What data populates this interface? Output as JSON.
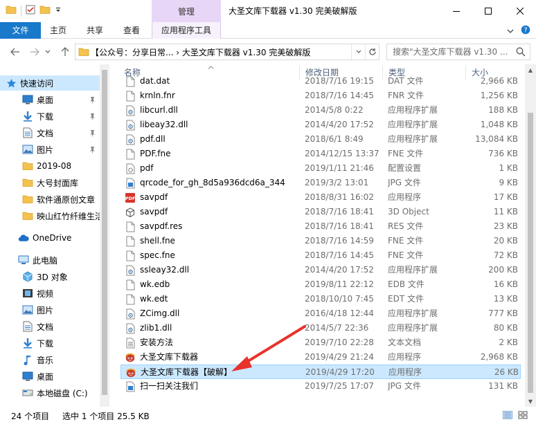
{
  "window": {
    "context_tab_group": "管理",
    "title": "大圣文库下载器 v1.30 完美破解版"
  },
  "ribbon": {
    "tabs": [
      "文件",
      "主页",
      "共享",
      "查看",
      "应用程序工具"
    ]
  },
  "address": {
    "path": "【公众号：分享日常... › 大圣文库下载器 v1.30 完美破解版",
    "search_placeholder": "搜索\"大圣文库下载器 v1.30 ..."
  },
  "nav": {
    "quick_access": "快速访问",
    "items": [
      {
        "label": "桌面",
        "icon": "desktop-icon",
        "pinned": true
      },
      {
        "label": "下载",
        "icon": "download-icon",
        "pinned": true
      },
      {
        "label": "文档",
        "icon": "document-icon",
        "pinned": true
      },
      {
        "label": "图片",
        "icon": "picture-icon",
        "pinned": true
      },
      {
        "label": "2019-08",
        "icon": "folder-icon",
        "pinned": false
      },
      {
        "label": "大号封面库",
        "icon": "folder-icon",
        "pinned": false
      },
      {
        "label": "软件通原创文章",
        "icon": "folder-icon",
        "pinned": false
      },
      {
        "label": "映山红竹纤维生活",
        "icon": "folder-icon",
        "pinned": false
      }
    ],
    "onedrive": "OneDrive",
    "this_pc": "此电脑",
    "pc_items": [
      {
        "label": "3D 对象",
        "icon": "3d-objects-icon"
      },
      {
        "label": "视频",
        "icon": "video-icon"
      },
      {
        "label": "图片",
        "icon": "picture-icon"
      },
      {
        "label": "文档",
        "icon": "document-icon"
      },
      {
        "label": "下载",
        "icon": "download-icon"
      },
      {
        "label": "音乐",
        "icon": "music-icon"
      },
      {
        "label": "桌面",
        "icon": "desktop-icon"
      },
      {
        "label": "本地磁盘 (C:)",
        "icon": "drive-icon"
      }
    ]
  },
  "columns": {
    "name": "名称",
    "date": "修改日期",
    "type": "类型",
    "size": "大小"
  },
  "files": [
    {
      "name": "dat.dat",
      "date": "2018/7/16 19:15",
      "type": "DAT 文件",
      "size": "2,966 KB",
      "icon": "file-icon"
    },
    {
      "name": "krnln.fnr",
      "date": "2018/7/16 14:45",
      "type": "FNR 文件",
      "size": "1,256 KB",
      "icon": "file-icon"
    },
    {
      "name": "libcurl.dll",
      "date": "2014/5/8 0:22",
      "type": "应用程序扩展",
      "size": "188 KB",
      "icon": "dll-icon"
    },
    {
      "name": "libeay32.dll",
      "date": "2014/4/20 17:52",
      "type": "应用程序扩展",
      "size": "1,048 KB",
      "icon": "dll-icon"
    },
    {
      "name": "pdf.dll",
      "date": "2018/6/1 8:49",
      "type": "应用程序扩展",
      "size": "13,084 KB",
      "icon": "dll-icon"
    },
    {
      "name": "PDF.fne",
      "date": "2014/12/15 13:37",
      "type": "FNE 文件",
      "size": "736 KB",
      "icon": "file-icon"
    },
    {
      "name": "pdf",
      "date": "2019/1/11 21:46",
      "type": "配置设置",
      "size": "1 KB",
      "icon": "config-icon"
    },
    {
      "name": "qrcode_for_gh_8d5a936dcd6a_344",
      "date": "2019/3/2 13:01",
      "type": "JPG 文件",
      "size": "9 KB",
      "icon": "image-file-icon"
    },
    {
      "name": "savpdf",
      "date": "2018/8/31 16:02",
      "type": "应用程序",
      "size": "17 KB",
      "icon": "pdf-app-icon"
    },
    {
      "name": "savpdf",
      "date": "2018/7/16 18:41",
      "type": "3D Object",
      "size": "11 KB",
      "icon": "3d-file-icon"
    },
    {
      "name": "savpdf.res",
      "date": "2018/7/16 18:41",
      "type": "RES 文件",
      "size": "23 KB",
      "icon": "file-icon"
    },
    {
      "name": "shell.fne",
      "date": "2018/7/16 14:59",
      "type": "FNE 文件",
      "size": "20 KB",
      "icon": "file-icon"
    },
    {
      "name": "spec.fne",
      "date": "2018/7/16 14:45",
      "type": "FNE 文件",
      "size": "72 KB",
      "icon": "file-icon"
    },
    {
      "name": "ssleay32.dll",
      "date": "2014/4/20 17:52",
      "type": "应用程序扩展",
      "size": "200 KB",
      "icon": "dll-icon"
    },
    {
      "name": "wk.edb",
      "date": "2019/8/11 22:12",
      "type": "EDB 文件",
      "size": "16 KB",
      "icon": "file-icon"
    },
    {
      "name": "wk.edt",
      "date": "2018/10/10 7:45",
      "type": "EDT 文件",
      "size": "13 KB",
      "icon": "file-icon"
    },
    {
      "name": "ZCimg.dll",
      "date": "2016/4/18 12:44",
      "type": "应用程序扩展",
      "size": "777 KB",
      "icon": "dll-icon"
    },
    {
      "name": "zlib1.dll",
      "date": "2014/5/7 22:36",
      "type": "应用程序扩展",
      "size": "80 KB",
      "icon": "dll-icon"
    },
    {
      "name": "安装方法",
      "date": "2019/7/10 22:28",
      "type": "文本文档",
      "size": "2 KB",
      "icon": "text-file-icon"
    },
    {
      "name": "大圣文库下载器",
      "date": "2019/4/29 21:24",
      "type": "应用程序",
      "size": "2,968 KB",
      "icon": "monkey-app-icon"
    },
    {
      "name": "大圣文库下载器【破解】",
      "date": "2019/4/29 17:20",
      "type": "应用程序",
      "size": "26 KB",
      "icon": "monkey-app-icon",
      "selected": true
    },
    {
      "name": "扫一扫关注我们",
      "date": "2019/7/25 17:07",
      "type": "JPG 文件",
      "size": "131 KB",
      "icon": "image-file-icon"
    }
  ],
  "status": {
    "count": "24 个项目",
    "selection": "选中 1 个项目  25.5 KB"
  },
  "colors": {
    "accent": "#1979ca",
    "selection": "#cce8ff",
    "context_tab": "#e8d6f6",
    "annotation_arrow": "#e8322c"
  }
}
